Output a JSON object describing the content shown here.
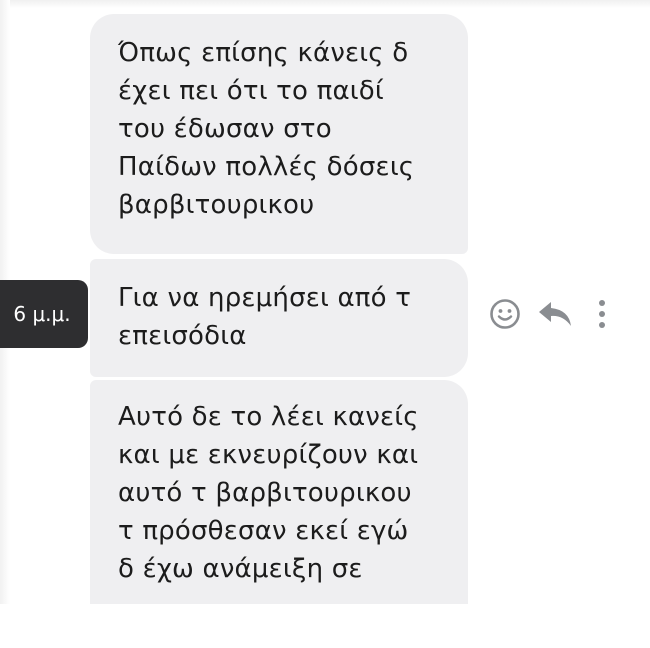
{
  "messages": [
    {
      "lines": [
        "Όπως επίσης κάνεις δ",
        "έχει πει ότι το παιδί",
        "του έδωσαν στο",
        "Παίδων πολλές δόσεις",
        "βαρβιτουρικου"
      ]
    },
    {
      "lines": [
        "Για να ηρεμήσει από τ",
        "επεισόδια"
      ]
    },
    {
      "lines": [
        "Αυτό δε το λέει κανείς",
        "και με εκνευρίζουν και",
        "αυτό τ βαρβιτουρικου",
        "τ πρόσθεσαν εκεί εγώ",
        "δ έχω ανάμειξη σε"
      ]
    }
  ],
  "timestamp_tooltip": "6 μ.μ.",
  "actions": {
    "react_icon": "smiley-face-icon",
    "reply_icon": "reply-arrow-icon",
    "more_icon": "vertical-ellipsis-icon"
  },
  "colors": {
    "bubble_bg": "#efeff1",
    "text": "#1c1c1c",
    "tooltip_bg": "#2e2e30",
    "tooltip_text": "#ffffff",
    "icon_gray": "#8a8d91"
  }
}
